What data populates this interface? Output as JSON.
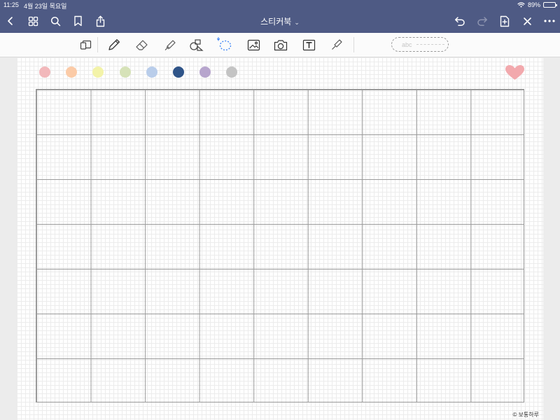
{
  "status_bar": {
    "time": "11:25",
    "date": "4월 23일 목요일",
    "battery_text": "89%",
    "battery_level": 0.89
  },
  "nav": {
    "title": "스티커북",
    "icons": [
      "back-icon",
      "grid-view-icon",
      "search-icon",
      "bookmark-icon",
      "share-icon",
      "undo-icon",
      "redo-icon",
      "add-page-icon",
      "close-icon",
      "more-icon"
    ]
  },
  "toolbar": {
    "tools": [
      "page-layout-icon",
      "pen-icon",
      "eraser-icon",
      "highlighter-icon",
      "shapes-icon",
      "lasso-icon",
      "image-icon",
      "camera-icon",
      "text-icon",
      "laser-pointer-icon"
    ],
    "handwriting_placeholder": "abc",
    "accent": "#3b82f6"
  },
  "page": {
    "swatches": [
      "#f2b8bb",
      "#fbcba7",
      "#f3f3a9",
      "#d6e2b8",
      "#b9cdea",
      "#2f5488",
      "#b7a5cd",
      "#c4c4c4"
    ],
    "heart_color": "#f2a9ad",
    "copyright": "© 보통하루"
  }
}
